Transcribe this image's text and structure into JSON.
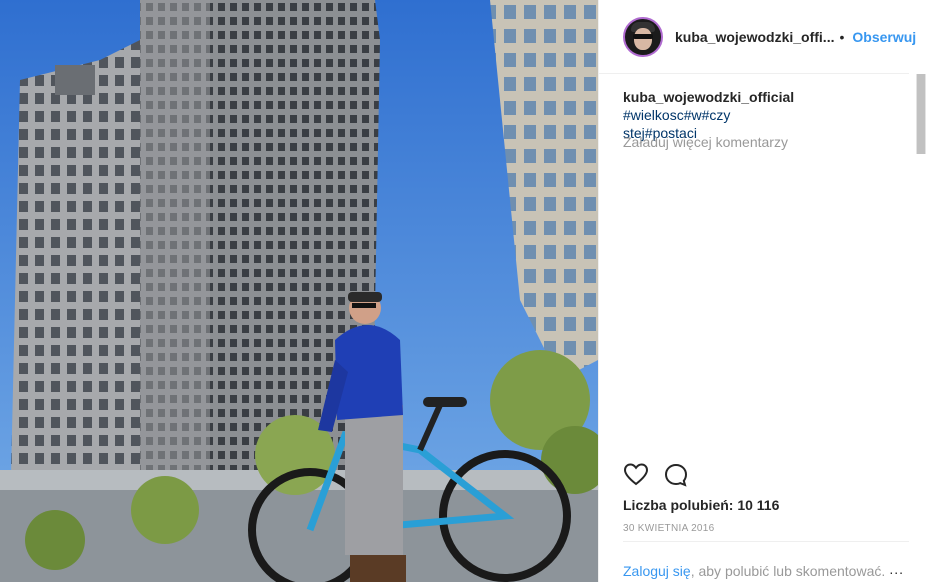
{
  "post": {
    "username": "kuba_wojewodzki_offi...",
    "follow_label": "Obserwuj",
    "separator": "•"
  },
  "caption": {
    "username": "kuba_wojewodzki_official",
    "tags_line1": "#wielkosc#w#czy",
    "tags_line2": "stej#postaci"
  },
  "comments": {
    "load_more": "Załaduj więcej komentarzy"
  },
  "actions": {
    "like_icon": "heart-icon",
    "comment_icon": "comment-icon"
  },
  "stats": {
    "likes": "Liczba polubień: 10 116",
    "date": "30 KWIETNIA 2016"
  },
  "footer": {
    "login_link": "Zaloguj się",
    "login_text": ", aby polubić lub skomentować.",
    "more_label": "..."
  },
  "colors": {
    "link_blue": "#3897f0",
    "hashtag": "#003569",
    "muted": "#999999"
  }
}
